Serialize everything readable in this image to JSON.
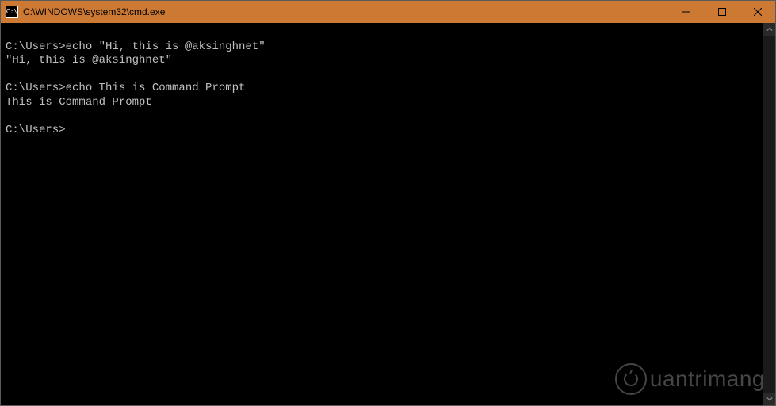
{
  "titlebar": {
    "icon_text": "C:\\",
    "title": "C:\\WINDOWS\\system32\\cmd.exe"
  },
  "terminal": {
    "lines": [
      "",
      "C:\\Users>echo \"Hi, this is @aksinghnet\"",
      "\"Hi, this is @aksinghnet\"",
      "",
      "C:\\Users>echo This is Command Prompt",
      "This is Command Prompt",
      "",
      "C:\\Users>"
    ]
  },
  "watermark": {
    "text": "uantrimang"
  }
}
